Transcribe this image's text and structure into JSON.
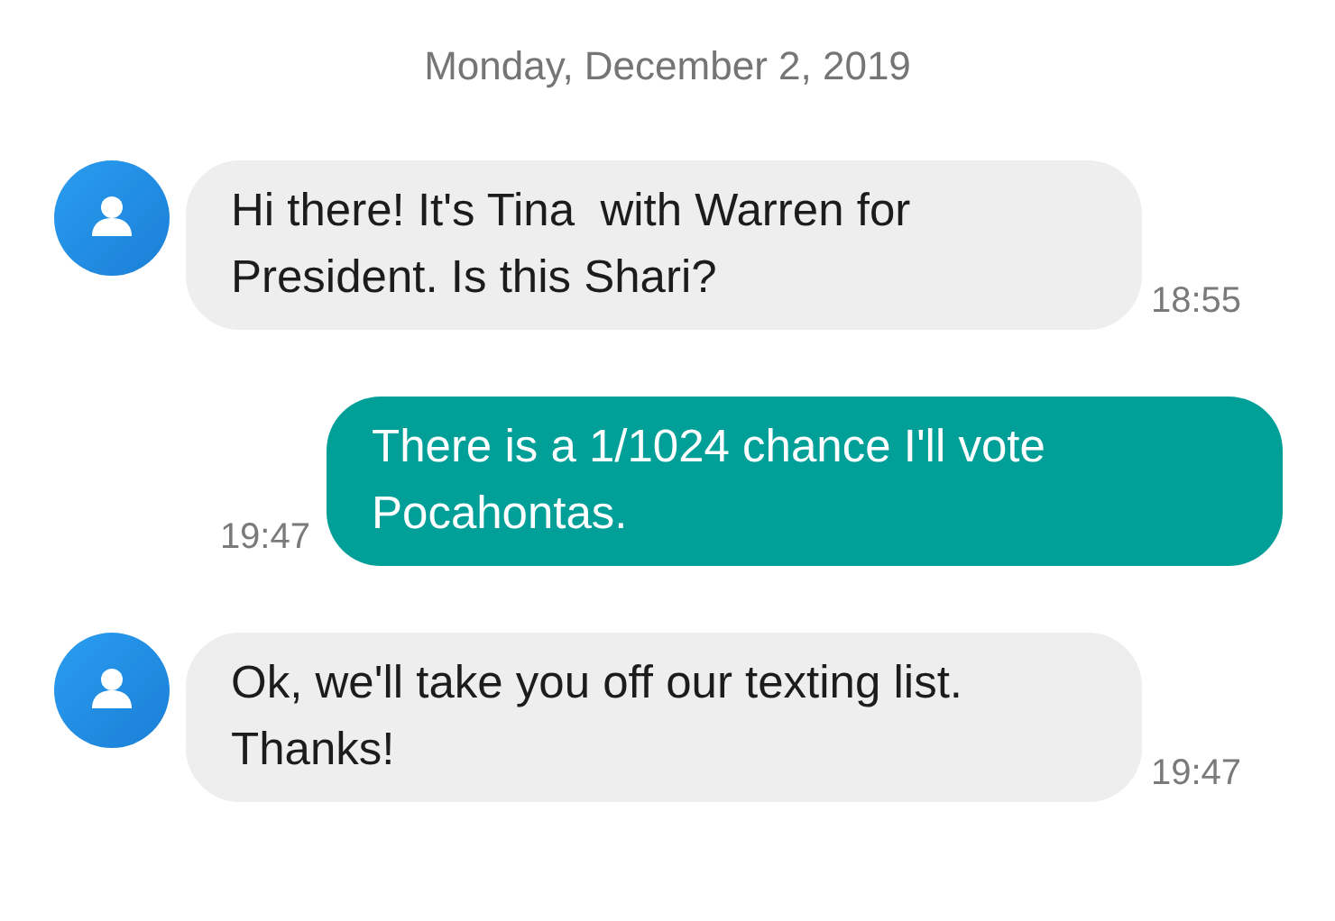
{
  "date": "Monday, December 2, 2019",
  "messages": [
    {
      "kind": "incoming",
      "text": "Hi there! It's Tina  with Warren for President. Is this Shari?",
      "time": "18:55"
    },
    {
      "kind": "outgoing",
      "text": "There is a 1/1024 chance I'll vote Pocahontas.",
      "time": "19:47"
    },
    {
      "kind": "incoming",
      "text": "Ok, we'll take you off our texting list. Thanks!",
      "time": "19:47"
    }
  ]
}
